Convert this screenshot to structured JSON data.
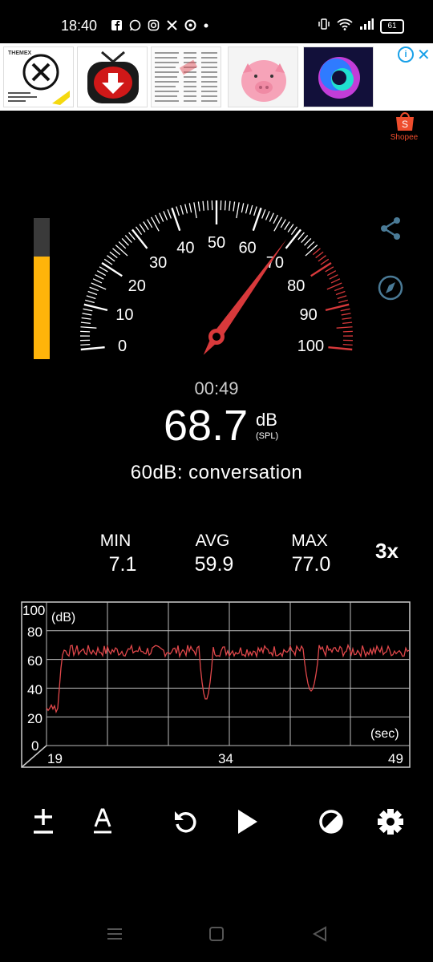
{
  "status_bar": {
    "time": "18:40",
    "battery": "61"
  },
  "ads": {
    "tiles": [
      "themeX-ad",
      "video-downloader-ad",
      "file-list-ad",
      "piggy-bank-ad",
      "colorful-logo-ad",
      "shopee-ad"
    ],
    "shopee_label": "Shopee",
    "themex_badge": "THEMEX"
  },
  "meter": {
    "gauge_labels": [
      "0",
      "10",
      "20",
      "30",
      "40",
      "50",
      "60",
      "70",
      "80",
      "90",
      "100"
    ],
    "needle_value": 68.7,
    "level_fraction": 0.73,
    "timer": "00:49",
    "reading": "68.7",
    "unit": "dB",
    "unit_sub": "(SPL)",
    "hint": "60dB: conversation",
    "colors": {
      "accent_red": "#d8393b",
      "level_yellow": "#ffb40a"
    }
  },
  "stats": {
    "min_label": "MIN",
    "min_value": "7.1",
    "avg_label": "AVG",
    "avg_value": "59.9",
    "max_label": "MAX",
    "max_value": "77.0",
    "multiplier": "3x"
  },
  "graph": {
    "y_ticks": [
      "100",
      "80",
      "60",
      "40",
      "20",
      "0"
    ],
    "y_unit": "(dB)",
    "x_unit": "(sec)",
    "x_ticks": [
      "19",
      "34",
      "49"
    ]
  },
  "toolbar": {
    "icons": [
      "calibrate-icon",
      "a-weighting-icon",
      "reset-icon",
      "play-icon",
      "theme-icon",
      "settings-icon"
    ]
  },
  "nav": {
    "icons": [
      "recent-apps-icon",
      "home-icon",
      "back-icon"
    ]
  }
}
